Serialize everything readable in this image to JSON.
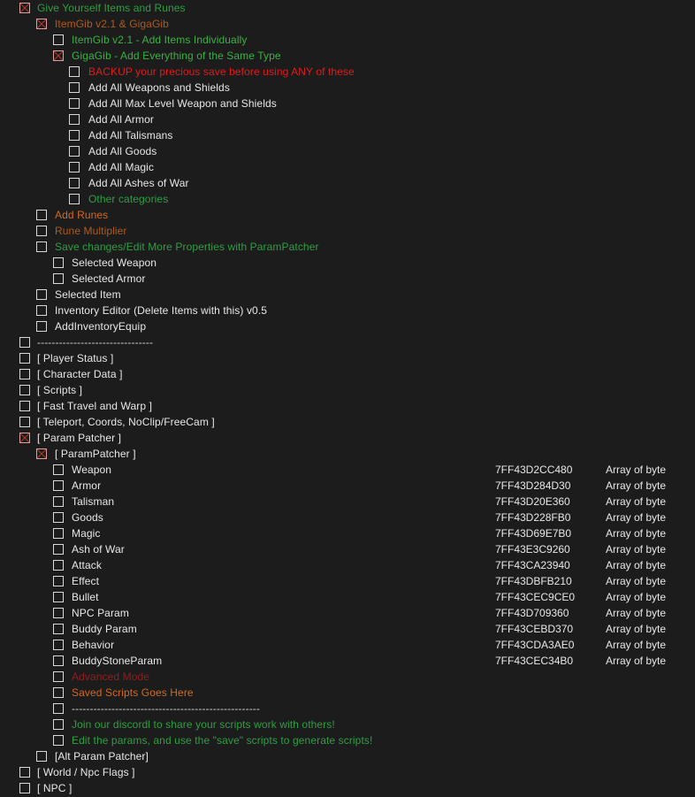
{
  "window": {
    "background": "#1c1c1c",
    "checkbox_border": "#d9d9d9",
    "check_mark_color": "#c0392b",
    "address_column_header": "",
    "type_column_header": ""
  },
  "colors": {
    "default": "#e8e8e8",
    "green": "#2f9e44",
    "lime": "#3cb043",
    "orange": "#d2691e",
    "brown": "#b05a18",
    "red": "#e01b1b",
    "darkred": "#8f1f1f"
  },
  "rows": [
    {
      "label": "Give Yourself Items and Runes",
      "indent": 0,
      "checked": true,
      "color": "green",
      "address": "",
      "type": ""
    },
    {
      "label": "ItemGib v2.1 & GigaGib",
      "indent": 1,
      "checked": true,
      "color": "brown",
      "address": "",
      "type": ""
    },
    {
      "label": "ItemGib v2.1 - Add Items Individually",
      "indent": 2,
      "checked": false,
      "color": "lime",
      "address": "",
      "type": ""
    },
    {
      "label": "GigaGib - Add Everything of the Same Type",
      "indent": 2,
      "checked": true,
      "color": "lime",
      "address": "",
      "type": ""
    },
    {
      "label": "BACKUP your precious save before using ANY of these",
      "indent": 3,
      "checked": false,
      "color": "red",
      "address": "",
      "type": ""
    },
    {
      "label": "Add All Weapons and Shields",
      "indent": 3,
      "checked": false,
      "color": "default",
      "address": "",
      "type": ""
    },
    {
      "label": "Add All Max Level Weapon and Shields",
      "indent": 3,
      "checked": false,
      "color": "default",
      "address": "",
      "type": ""
    },
    {
      "label": "Add All Armor",
      "indent": 3,
      "checked": false,
      "color": "default",
      "address": "",
      "type": ""
    },
    {
      "label": "Add All Talismans",
      "indent": 3,
      "checked": false,
      "color": "default",
      "address": "",
      "type": ""
    },
    {
      "label": "Add All Goods",
      "indent": 3,
      "checked": false,
      "color": "default",
      "address": "",
      "type": ""
    },
    {
      "label": "Add All Magic",
      "indent": 3,
      "checked": false,
      "color": "default",
      "address": "",
      "type": ""
    },
    {
      "label": "Add All Ashes of War",
      "indent": 3,
      "checked": false,
      "color": "default",
      "address": "",
      "type": ""
    },
    {
      "label": "Other categories",
      "indent": 3,
      "checked": false,
      "color": "green",
      "address": "",
      "type": ""
    },
    {
      "label": "Add Runes",
      "indent": 1,
      "checked": false,
      "color": "orange",
      "address": "",
      "type": ""
    },
    {
      "label": "Rune Multiplier",
      "indent": 1,
      "checked": false,
      "color": "brown",
      "address": "",
      "type": ""
    },
    {
      "label": "Save changes/Edit More Properties with ParamPatcher",
      "indent": 1,
      "checked": false,
      "color": "green",
      "address": "",
      "type": ""
    },
    {
      "label": "Selected Weapon",
      "indent": 2,
      "checked": false,
      "color": "default",
      "address": "",
      "type": ""
    },
    {
      "label": "Selected Armor",
      "indent": 2,
      "checked": false,
      "color": "default",
      "address": "",
      "type": ""
    },
    {
      "label": "Selected Item",
      "indent": 1,
      "checked": false,
      "color": "default",
      "address": "",
      "type": ""
    },
    {
      "label": "Inventory Editor (Delete Items with this) v0.5",
      "indent": 1,
      "checked": false,
      "color": "default",
      "address": "",
      "type": ""
    },
    {
      "label": "AddInventoryEquip",
      "indent": 1,
      "checked": false,
      "color": "default",
      "address": "",
      "type": ""
    },
    {
      "label": "--------------------------------",
      "indent": 0,
      "checked": false,
      "color": "dim",
      "address": "",
      "type": ""
    },
    {
      "label": "[ Player Status ]",
      "indent": 0,
      "checked": false,
      "color": "default",
      "address": "",
      "type": ""
    },
    {
      "label": "[ Character Data ]",
      "indent": 0,
      "checked": false,
      "color": "default",
      "address": "",
      "type": ""
    },
    {
      "label": "[ Scripts ]",
      "indent": 0,
      "checked": false,
      "color": "default",
      "address": "",
      "type": ""
    },
    {
      "label": "[ Fast Travel and Warp ]",
      "indent": 0,
      "checked": false,
      "color": "default",
      "address": "",
      "type": ""
    },
    {
      "label": "[ Teleport, Coords, NoClip/FreeCam ]",
      "indent": 0,
      "checked": false,
      "color": "default",
      "address": "",
      "type": ""
    },
    {
      "label": "[ Param Patcher ]",
      "indent": 0,
      "checked": true,
      "color": "default",
      "address": "",
      "type": ""
    },
    {
      "label": "[ ParamPatcher ]",
      "indent": 1,
      "checked": true,
      "color": "default",
      "address": "",
      "type": ""
    },
    {
      "label": "Weapon",
      "indent": 2,
      "checked": false,
      "color": "default",
      "address": "7FF43D2CC480",
      "type": "Array of byte"
    },
    {
      "label": "Armor",
      "indent": 2,
      "checked": false,
      "color": "default",
      "address": "7FF43D284D30",
      "type": "Array of byte"
    },
    {
      "label": "Talisman",
      "indent": 2,
      "checked": false,
      "color": "default",
      "address": "7FF43D20E360",
      "type": "Array of byte"
    },
    {
      "label": "Goods",
      "indent": 2,
      "checked": false,
      "color": "default",
      "address": "7FF43D228FB0",
      "type": "Array of byte"
    },
    {
      "label": "Magic",
      "indent": 2,
      "checked": false,
      "color": "default",
      "address": "7FF43D69E7B0",
      "type": "Array of byte"
    },
    {
      "label": "Ash of War",
      "indent": 2,
      "checked": false,
      "color": "default",
      "address": "7FF43E3C9260",
      "type": "Array of byte"
    },
    {
      "label": "Attack",
      "indent": 2,
      "checked": false,
      "color": "default",
      "address": "7FF43CA23940",
      "type": "Array of byte"
    },
    {
      "label": "Effect",
      "indent": 2,
      "checked": false,
      "color": "default",
      "address": "7FF43DBFB210",
      "type": "Array of byte"
    },
    {
      "label": "Bullet",
      "indent": 2,
      "checked": false,
      "color": "default",
      "address": "7FF43CEC9CE0",
      "type": "Array of byte"
    },
    {
      "label": "NPC Param",
      "indent": 2,
      "checked": false,
      "color": "default",
      "address": "7FF43D709360",
      "type": "Array of byte"
    },
    {
      "label": "Buddy Param",
      "indent": 2,
      "checked": false,
      "color": "default",
      "address": "7FF43CEBD370",
      "type": "Array of byte"
    },
    {
      "label": "Behavior",
      "indent": 2,
      "checked": false,
      "color": "default",
      "address": "7FF43CDA3AE0",
      "type": "Array of byte"
    },
    {
      "label": "BuddyStoneParam",
      "indent": 2,
      "checked": false,
      "color": "default",
      "address": "7FF43CEC34B0",
      "type": "Array of byte"
    },
    {
      "label": "Advanced Mode",
      "indent": 2,
      "checked": false,
      "color": "darkred",
      "address": "",
      "type": ""
    },
    {
      "label": "Saved Scripts Goes Here",
      "indent": 2,
      "checked": false,
      "color": "orange",
      "address": "",
      "type": ""
    },
    {
      "label": "----------------------------------------------------",
      "indent": 2,
      "checked": false,
      "color": "dim",
      "address": "",
      "type": ""
    },
    {
      "label": "Join our discordl to share your scripts work with others!",
      "indent": 2,
      "checked": false,
      "color": "green",
      "address": "",
      "type": ""
    },
    {
      "label": "Edit the params, and use the \"save\" scripts to generate scripts!",
      "indent": 2,
      "checked": false,
      "color": "green",
      "address": "",
      "type": ""
    },
    {
      "label": "[Alt Param Patcher]",
      "indent": 1,
      "checked": false,
      "color": "default",
      "address": "",
      "type": ""
    },
    {
      "label": "[ World / Npc Flags ]",
      "indent": 0,
      "checked": false,
      "color": "default",
      "address": "",
      "type": ""
    },
    {
      "label": "[ NPC ]",
      "indent": 0,
      "checked": false,
      "color": "default",
      "address": "",
      "type": ""
    }
  ]
}
